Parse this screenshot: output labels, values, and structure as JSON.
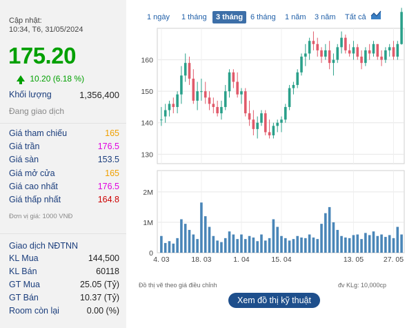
{
  "updated": {
    "label": "Cập nhật:",
    "time": "10:34, T6, 31/05/2024"
  },
  "price": "175.20",
  "change": "10.20 (6.18 %)",
  "volume": {
    "label": "Khối lượng",
    "value": "1,356,400"
  },
  "status": "Đang giao dịch",
  "price_stats": [
    {
      "label": "Giá tham chiếu",
      "value": "165",
      "color": "#f0a000"
    },
    {
      "label": "Giá trần",
      "value": "176.5",
      "color": "#e000e0"
    },
    {
      "label": "Giá sàn",
      "value": "153.5",
      "color": "#1a3d7c"
    },
    {
      "label": "Giá mở cửa",
      "value": "165",
      "color": "#f0a000"
    },
    {
      "label": "Giá cao nhất",
      "value": "176.5",
      "color": "#e000e0"
    },
    {
      "label": "Giá thấp nhất",
      "value": "164.8",
      "color": "#cc0000"
    }
  ],
  "unit": "Đơn vị giá: 1000 VNĐ",
  "foreign": {
    "title": "Giao dịch NĐTNN",
    "rows": [
      {
        "label": "KL Mua",
        "value": "144,500"
      },
      {
        "label": "KL Bán",
        "value": "60118"
      },
      {
        "label": "GT Mua",
        "value": "25.05 (Tỷ)"
      },
      {
        "label": "GT Bán",
        "value": "10.37 (Tỷ)"
      },
      {
        "label": "Room còn lại",
        "value": "0.00 (%)"
      }
    ]
  },
  "tabs": [
    "1 ngày",
    "1 tháng",
    "3 tháng",
    "6 tháng",
    "1 năm",
    "3 năm",
    "Tất cả"
  ],
  "active_tab": "3 tháng",
  "chart_icon": "area-chart-icon",
  "note_left": "Đồ thị vẽ theo giá điều chỉnh",
  "note_right": "đv KLg: 10,000cp",
  "tech_button": "Xem đồ thị kỹ thuật",
  "colors": {
    "up": "#2aa08a",
    "down": "#e05a6a",
    "volume": "#4a86b8",
    "accent": "#1e4f8c",
    "green": "#00a000"
  },
  "chart_data": {
    "type": "candlestick",
    "price_axis": {
      "ticks": [
        130,
        140,
        150,
        160
      ],
      "ylim": [
        127,
        170
      ]
    },
    "volume_axis": {
      "ticks": [
        "0",
        "1M",
        "2M"
      ],
      "tick_values": [
        0,
        100,
        200
      ],
      "ylim": [
        0,
        270
      ]
    },
    "x_labels": [
      {
        "label": "4. 03",
        "index": 0
      },
      {
        "label": "18. 03",
        "index": 10
      },
      {
        "label": "1. 04",
        "index": 20
      },
      {
        "label": "15. 04",
        "index": 30
      },
      {
        "label": "13. 05",
        "index": 48
      },
      {
        "label": "27. 05",
        "index": 58
      }
    ],
    "candles": [
      {
        "o": 141,
        "h": 145,
        "l": 139,
        "c": 141
      },
      {
        "o": 142,
        "h": 146,
        "l": 140,
        "c": 144
      },
      {
        "o": 144,
        "h": 147,
        "l": 142,
        "c": 146
      },
      {
        "o": 146,
        "h": 148,
        "l": 143,
        "c": 145
      },
      {
        "o": 145,
        "h": 150,
        "l": 143,
        "c": 149
      },
      {
        "o": 149,
        "h": 158,
        "l": 146,
        "c": 155
      },
      {
        "o": 155,
        "h": 162,
        "l": 153,
        "c": 159
      },
      {
        "o": 159,
        "h": 161,
        "l": 152,
        "c": 154
      },
      {
        "o": 154,
        "h": 157,
        "l": 146,
        "c": 147
      },
      {
        "o": 147,
        "h": 153,
        "l": 144,
        "c": 150
      },
      {
        "o": 150,
        "h": 154,
        "l": 147,
        "c": 150
      },
      {
        "o": 150,
        "h": 153,
        "l": 146,
        "c": 148
      },
      {
        "o": 148,
        "h": 150,
        "l": 144,
        "c": 146
      },
      {
        "o": 146,
        "h": 148,
        "l": 143,
        "c": 145
      },
      {
        "o": 145,
        "h": 147,
        "l": 142,
        "c": 143
      },
      {
        "o": 143,
        "h": 147,
        "l": 141,
        "c": 145
      },
      {
        "o": 145,
        "h": 152,
        "l": 144,
        "c": 150
      },
      {
        "o": 150,
        "h": 157,
        "l": 148,
        "c": 156
      },
      {
        "o": 156,
        "h": 157,
        "l": 151,
        "c": 153
      },
      {
        "o": 153,
        "h": 156,
        "l": 148,
        "c": 149
      },
      {
        "o": 149,
        "h": 151,
        "l": 146,
        "c": 150
      },
      {
        "o": 150,
        "h": 151,
        "l": 142,
        "c": 143
      },
      {
        "o": 143,
        "h": 147,
        "l": 139,
        "c": 141
      },
      {
        "o": 141,
        "h": 144,
        "l": 136,
        "c": 138
      },
      {
        "o": 138,
        "h": 142,
        "l": 135,
        "c": 140
      },
      {
        "o": 140,
        "h": 144,
        "l": 139,
        "c": 143
      },
      {
        "o": 143,
        "h": 144,
        "l": 136,
        "c": 137
      },
      {
        "o": 137,
        "h": 141,
        "l": 135,
        "c": 136
      },
      {
        "o": 136,
        "h": 140,
        "l": 135,
        "c": 139
      },
      {
        "o": 139,
        "h": 141,
        "l": 137,
        "c": 140
      },
      {
        "o": 140,
        "h": 142,
        "l": 137,
        "c": 141
      },
      {
        "o": 141,
        "h": 146,
        "l": 140,
        "c": 145
      },
      {
        "o": 145,
        "h": 152,
        "l": 144,
        "c": 151
      },
      {
        "o": 151,
        "h": 153,
        "l": 149,
        "c": 152
      },
      {
        "o": 152,
        "h": 157,
        "l": 151,
        "c": 156
      },
      {
        "o": 156,
        "h": 162,
        "l": 155,
        "c": 161
      },
      {
        "o": 161,
        "h": 165,
        "l": 158,
        "c": 162
      },
      {
        "o": 162,
        "h": 167,
        "l": 160,
        "c": 166
      },
      {
        "o": 166,
        "h": 169,
        "l": 163,
        "c": 165
      },
      {
        "o": 165,
        "h": 167,
        "l": 161,
        "c": 163
      },
      {
        "o": 163,
        "h": 164,
        "l": 159,
        "c": 161
      },
      {
        "o": 161,
        "h": 165,
        "l": 160,
        "c": 163
      },
      {
        "o": 163,
        "h": 166,
        "l": 157,
        "c": 159
      },
      {
        "o": 159,
        "h": 162,
        "l": 155,
        "c": 160
      },
      {
        "o": 160,
        "h": 165,
        "l": 159,
        "c": 164
      },
      {
        "o": 164,
        "h": 169,
        "l": 162,
        "c": 167
      },
      {
        "o": 167,
        "h": 168,
        "l": 162,
        "c": 163
      },
      {
        "o": 163,
        "h": 165,
        "l": 161,
        "c": 162
      },
      {
        "o": 162,
        "h": 166,
        "l": 160,
        "c": 164
      },
      {
        "o": 164,
        "h": 165,
        "l": 160,
        "c": 161
      },
      {
        "o": 161,
        "h": 163,
        "l": 157,
        "c": 159
      },
      {
        "o": 159,
        "h": 164,
        "l": 158,
        "c": 163
      },
      {
        "o": 163,
        "h": 165,
        "l": 160,
        "c": 162
      },
      {
        "o": 162,
        "h": 166,
        "l": 161,
        "c": 165
      },
      {
        "o": 165,
        "h": 165,
        "l": 160,
        "c": 161
      },
      {
        "o": 161,
        "h": 163,
        "l": 158,
        "c": 160
      },
      {
        "o": 160,
        "h": 164,
        "l": 159,
        "c": 163
      },
      {
        "o": 163,
        "h": 165,
        "l": 161,
        "c": 164
      },
      {
        "o": 164,
        "h": 166,
        "l": 160,
        "c": 161
      },
      {
        "o": 161,
        "h": 166,
        "l": 160,
        "c": 165
      },
      {
        "o": 165,
        "h": 176.5,
        "l": 164.8,
        "c": 175.2
      }
    ],
    "volumes": [
      55,
      32,
      38,
      30,
      48,
      110,
      95,
      75,
      60,
      45,
      165,
      120,
      85,
      55,
      40,
      35,
      48,
      70,
      60,
      45,
      60,
      45,
      55,
      50,
      38,
      60,
      40,
      48,
      110,
      85,
      55,
      48,
      40,
      45,
      55,
      50,
      48,
      60,
      50,
      45,
      95,
      130,
      150,
      100,
      75,
      55,
      50,
      48,
      58,
      60,
      45,
      65,
      58,
      70,
      55,
      60,
      52,
      58,
      48,
      85,
      60
    ]
  }
}
